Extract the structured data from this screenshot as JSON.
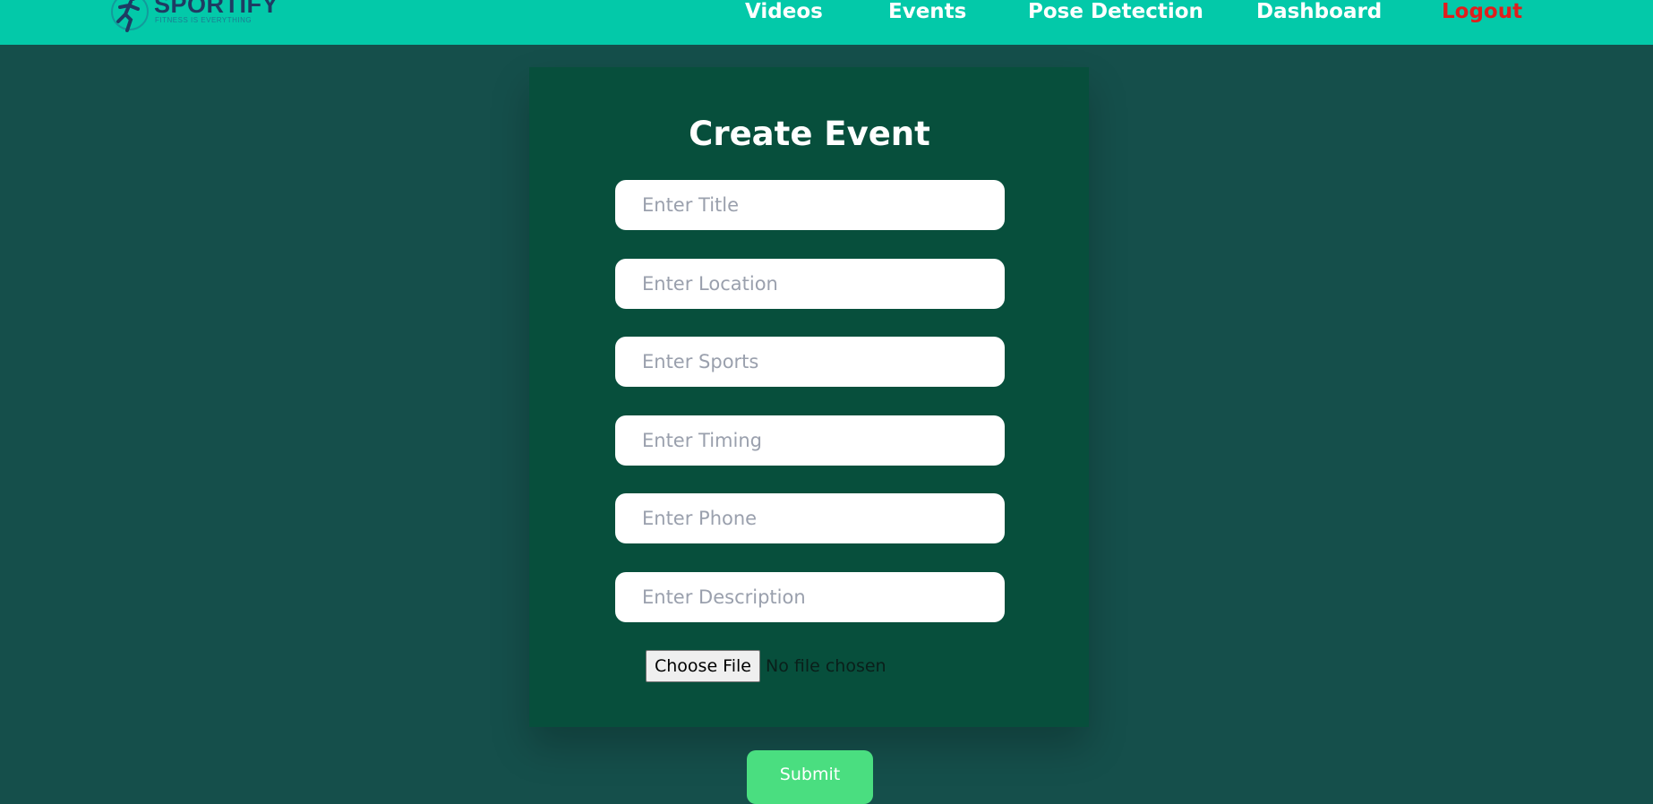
{
  "brand": {
    "name": "SPORTIFY",
    "tagline": "FITNESS IS EVERYTHING"
  },
  "nav": {
    "videos": "Videos",
    "events": "Events",
    "pose_detection": "Pose Detection",
    "dashboard": "Dashboard",
    "logout": "Logout"
  },
  "form": {
    "title": "Create Event",
    "fields": {
      "title": "Enter Title",
      "location": "Enter Location",
      "sports": "Enter Sports",
      "timing": "Enter Timing",
      "phone": "Enter Phone",
      "description": "Enter Description"
    },
    "file": {
      "button": "Choose File",
      "status": "No file chosen"
    },
    "submit": "Submit"
  },
  "colors": {
    "page_background": "#154f4b",
    "navbar": "#03c9a9",
    "card": "#074f3c",
    "logout": "#e11d1d",
    "submit": "#4ade80"
  }
}
